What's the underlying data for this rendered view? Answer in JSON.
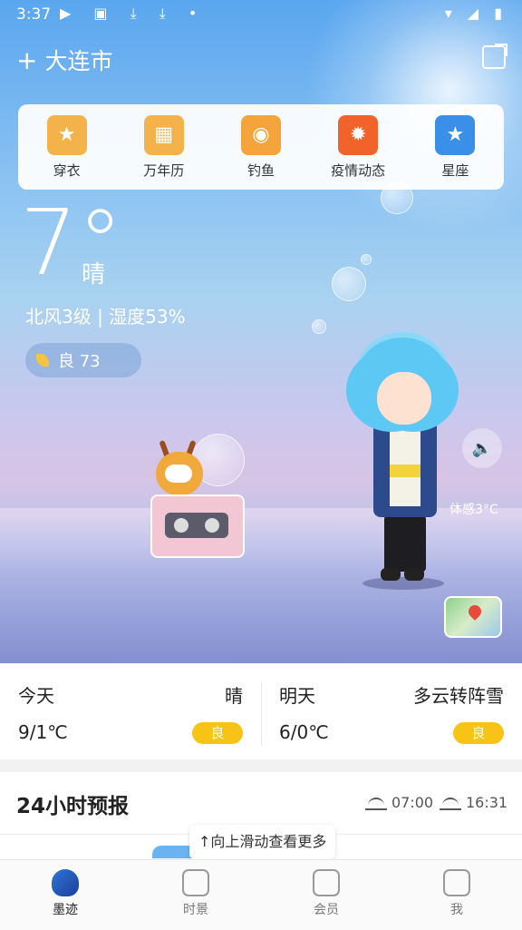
{
  "status_bar": {
    "time": "3:37",
    "left_icons": "▶ ▣ ⤓ ⤓ •",
    "right_icons": "▾ ◢ ▮"
  },
  "header": {
    "add_icon": "+",
    "city": "大连市",
    "share_icon": "share-icon"
  },
  "shortcuts": [
    {
      "label": "穿衣",
      "icon": "shirt-icon",
      "color": "#f4b24a",
      "glyph": "★"
    },
    {
      "label": "万年历",
      "icon": "calendar-icon",
      "color": "#f4b24a",
      "glyph": "▦"
    },
    {
      "label": "钓鱼",
      "icon": "fish-icon",
      "color": "#f4a43a",
      "glyph": "◉"
    },
    {
      "label": "疫情动态",
      "icon": "virus-shield-icon",
      "color": "#f1632a",
      "glyph": "✹"
    },
    {
      "label": "星座",
      "icon": "star-icon",
      "color": "#3a8fe8",
      "glyph": "★"
    }
  ],
  "weather": {
    "temperature": "7°",
    "condition": "晴",
    "wind_humidity": "北风3级 | 湿度53%",
    "aqi": "良 73",
    "feels_like": "体感3°C"
  },
  "daily": {
    "today": {
      "name": "今天",
      "condition": "晴",
      "range": "9/1℃",
      "badge": "良"
    },
    "tomorrow": {
      "name": "明天",
      "condition": "多云转阵雪",
      "range": "6/0℃",
      "badge": "良"
    }
  },
  "hourly": {
    "title": "24小时预报",
    "sunrise": "07:00",
    "sunset": "16:31",
    "hint": "↑向上滑动查看更多"
  },
  "nav": [
    {
      "label": "墨迹",
      "icon": "moji-logo-icon",
      "active": true
    },
    {
      "label": "时景",
      "icon": "picture-icon",
      "active": false
    },
    {
      "label": "会员",
      "icon": "vip-icon",
      "active": false
    },
    {
      "label": "我",
      "icon": "profile-icon",
      "active": false
    }
  ],
  "colors": {
    "badge": "#f7c314",
    "accent": "#2f74d6"
  }
}
